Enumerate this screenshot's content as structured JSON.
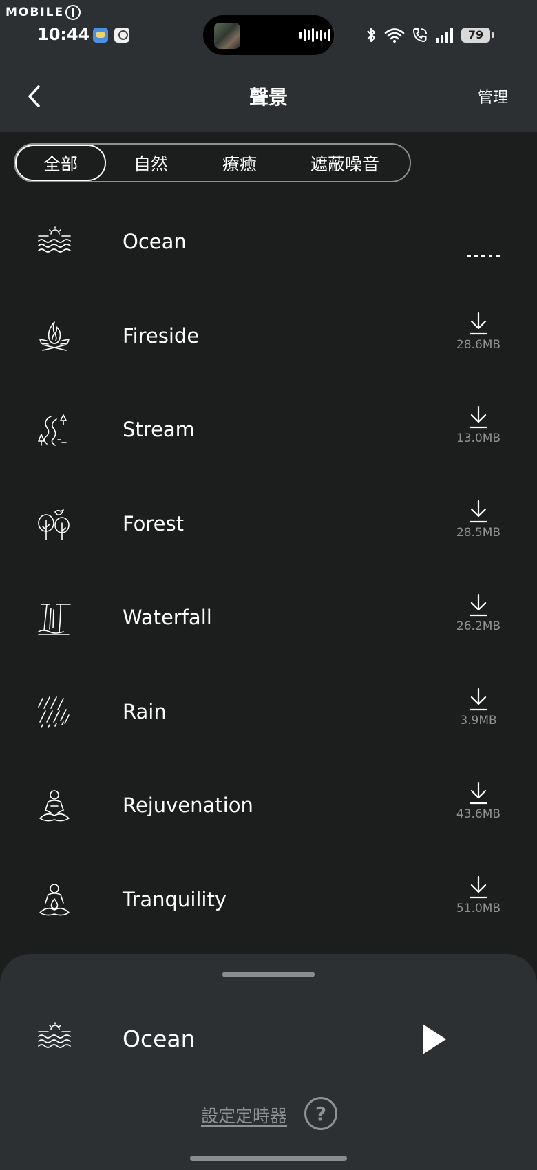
{
  "watermark": {
    "text": "MOBILE"
  },
  "status_bar": {
    "time": "10:44",
    "battery": "79",
    "icons": [
      "weather-app-icon",
      "app-icon",
      "bluetooth-icon",
      "wifi-icon",
      "wifi-calling-icon",
      "signal-icon",
      "battery-icon"
    ]
  },
  "header": {
    "title": "聲景",
    "manage_label": "管理",
    "back_icon": "chevron-left-icon"
  },
  "tabs": [
    {
      "label": "全部",
      "active": true
    },
    {
      "label": "自然",
      "active": false
    },
    {
      "label": "療癒",
      "active": false
    },
    {
      "label": "遮蔽噪音",
      "active": false
    }
  ],
  "soundscapes": [
    {
      "name": "Ocean",
      "icon": "ocean-waves-icon",
      "size": "",
      "state": "downloading"
    },
    {
      "name": "Fireside",
      "icon": "campfire-icon",
      "size": "28.6MB",
      "state": "download"
    },
    {
      "name": "Stream",
      "icon": "stream-icon",
      "size": "13.0MB",
      "state": "download"
    },
    {
      "name": "Forest",
      "icon": "forest-icon",
      "size": "28.5MB",
      "state": "download"
    },
    {
      "name": "Waterfall",
      "icon": "waterfall-icon",
      "size": "26.2MB",
      "state": "download"
    },
    {
      "name": "Rain",
      "icon": "rain-icon",
      "size": "3.9MB",
      "state": "download"
    },
    {
      "name": "Rejuvenation",
      "icon": "meditation-icon",
      "size": "43.6MB",
      "state": "download"
    },
    {
      "name": "Tranquility",
      "icon": "meditation-drop-icon",
      "size": "51.0MB",
      "state": "download"
    }
  ],
  "now_playing": {
    "title": "Ocean",
    "icon": "ocean-waves-icon",
    "play_icon": "play-icon",
    "timer_label": "設定定時器",
    "help_icon": "help-circle-icon"
  },
  "colors": {
    "background": "#1c1d1d",
    "surface": "#2d3032",
    "text": "#ffffff",
    "muted": "#8f9192"
  }
}
